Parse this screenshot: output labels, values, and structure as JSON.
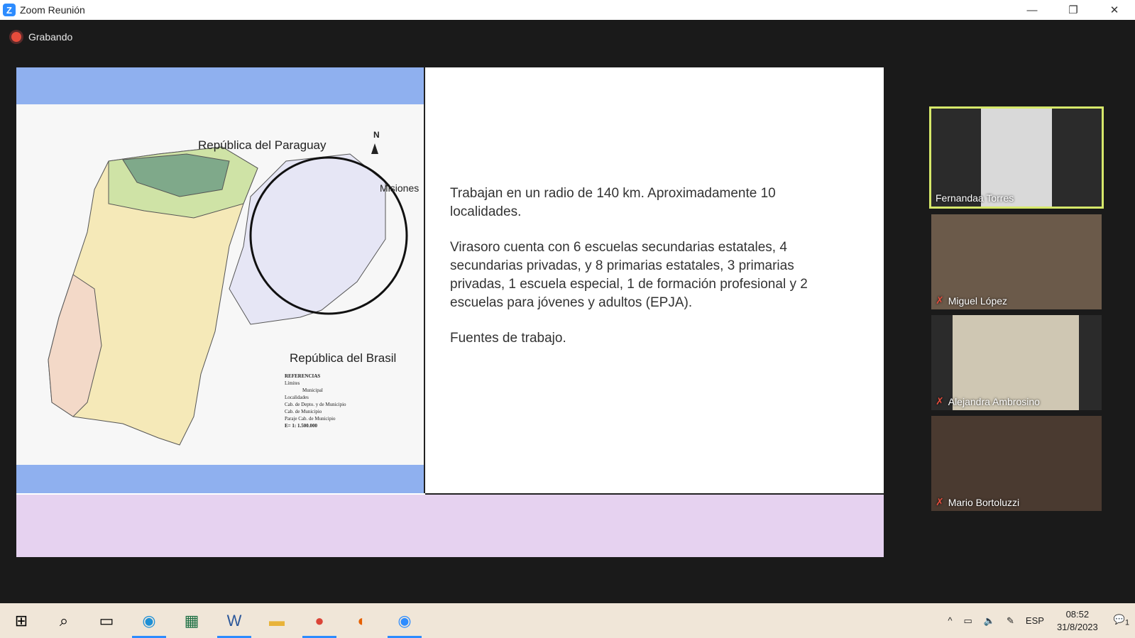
{
  "window": {
    "title": "Zoom Reunión",
    "icon": "zoom-logo-icon"
  },
  "recording": {
    "label": "Grabando"
  },
  "slide": {
    "map_labels": {
      "paraguay": "República del Paraguay",
      "brasil": "República del Brasil",
      "misiones": "Misiones",
      "north": "N",
      "legend_title": "REFERENCIAS",
      "legend_limits": "Límites",
      "legend_municipal": "Municipal",
      "legend_localidades": "Localidades",
      "legend_item1": "Cab. de Depto. y de Municipio",
      "legend_item2": "Cab. de Municipio",
      "legend_item3": "Paraje Cab. de Municipio",
      "legend_scale": "E= 1: 1.500.000"
    },
    "paragraphs": [
      "Trabajan en un radio de 140 km. Aproximadamente 10 localidades.",
      "Virasoro cuenta con 6 escuelas secundarias estatales, 4 secundarias privadas, y 8 primarias estatales, 3 primarias privadas, 1 escuela especial, 1 de formación profesional y 2 escuelas para jóvenes y adultos (EPJA).",
      "Fuentes de trabajo."
    ]
  },
  "participants": [
    {
      "name": "Fernandaa Torres",
      "muted": false,
      "active": true
    },
    {
      "name": "Miguel López",
      "muted": true,
      "active": false
    },
    {
      "name": "Alejandra Ambrosino",
      "muted": true,
      "active": false
    },
    {
      "name": "Mario Bortoluzzi",
      "muted": true,
      "active": false
    }
  ],
  "taskbar": {
    "language": "ESP",
    "time": "08:52",
    "date": "31/8/2023",
    "notifications": "1"
  },
  "colors": {
    "slide_top": "#8fb0ef",
    "slide_bottom": "#e6d2f0",
    "active_speaker": "#d6e86a"
  }
}
